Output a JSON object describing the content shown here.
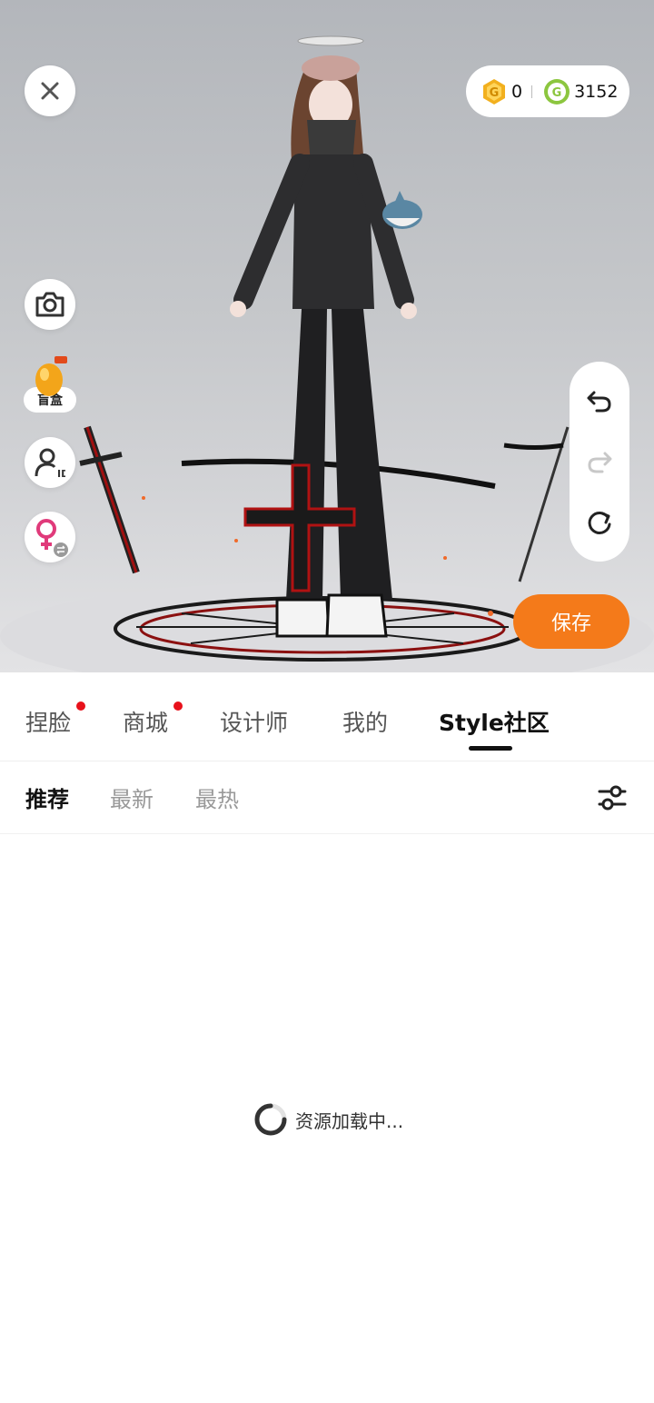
{
  "top_bar": {
    "coins": [
      {
        "icon": "gold-coin-icon",
        "value": "0",
        "color": "#f2b01e"
      },
      {
        "icon": "green-coin-icon",
        "value": "3152",
        "color": "#8cc63f"
      }
    ]
  },
  "side_tools": {
    "blind_box_label": "盲盒"
  },
  "actions": {
    "save_label": "保存",
    "accent_color": "#f47a1a"
  },
  "main_tabs": [
    {
      "label": "捏脸",
      "has_dot": true,
      "active": false
    },
    {
      "label": "商城",
      "has_dot": true,
      "active": false
    },
    {
      "label": "设计师",
      "has_dot": false,
      "active": false
    },
    {
      "label": "我的",
      "has_dot": false,
      "active": false
    },
    {
      "label": "Style社区",
      "has_dot": false,
      "active": true
    }
  ],
  "sub_tabs": [
    {
      "label": "推荐",
      "active": true
    },
    {
      "label": "最新",
      "active": false
    },
    {
      "label": "最热",
      "active": false
    }
  ],
  "content": {
    "loading_text": "资源加载中..."
  }
}
